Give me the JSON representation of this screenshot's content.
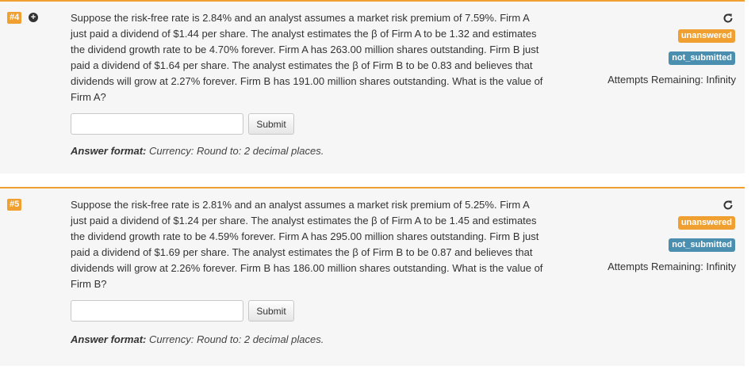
{
  "questions": [
    {
      "number": "#4",
      "has_plus_icon": true,
      "text": "Suppose the risk-free rate is 2.84% and an analyst assumes a market risk premium of 7.59%. Firm A just paid a dividend of $1.44 per share. The analyst estimates the β of Firm A to be 1.32 and estimates the dividend growth rate to be 4.70% forever. Firm A has 263.00 million shares outstanding. Firm B just paid a dividend of $1.64 per share. The analyst estimates the β of Firm B to be 0.83 and believes that dividends will grow at 2.27% forever. Firm B has 191.00 million shares outstanding. What is the value of Firm A?",
      "input_value": "",
      "submit_label": "Submit",
      "answer_format_label": "Answer format:",
      "answer_format_text": "Currency: Round to: 2 decimal places.",
      "status_answer": "unanswered",
      "status_submission": "not_submitted",
      "attempts_text": "Attempts Remaining: Infinity"
    },
    {
      "number": "#5",
      "has_plus_icon": false,
      "text": "Suppose the risk-free rate is 2.81% and an analyst assumes a market risk premium of 5.25%. Firm A just paid a dividend of $1.24 per share. The analyst estimates the β of Firm A to be 1.45 and estimates the dividend growth rate to be 4.59% forever. Firm A has 295.00 million shares outstanding. Firm B just paid a dividend of $1.69 per share. The analyst estimates the β of Firm B to be 0.87 and believes that dividends will grow at 2.26% forever. Firm B has 186.00 million shares outstanding. What is the value of Firm B?",
      "input_value": "",
      "submit_label": "Submit",
      "answer_format_label": "Answer format:",
      "answer_format_text": "Currency: Round to: 2 decimal places.",
      "status_answer": "unanswered",
      "status_submission": "not_submitted",
      "attempts_text": "Attempts Remaining: Infinity"
    }
  ],
  "colors": {
    "accent_orange": "#f0a030",
    "not_submitted_blue": "#4a8fb0",
    "card_background": "#f6f6f6"
  },
  "icons": {
    "plus": "plus-circle-icon",
    "refresh": "refresh-icon"
  }
}
